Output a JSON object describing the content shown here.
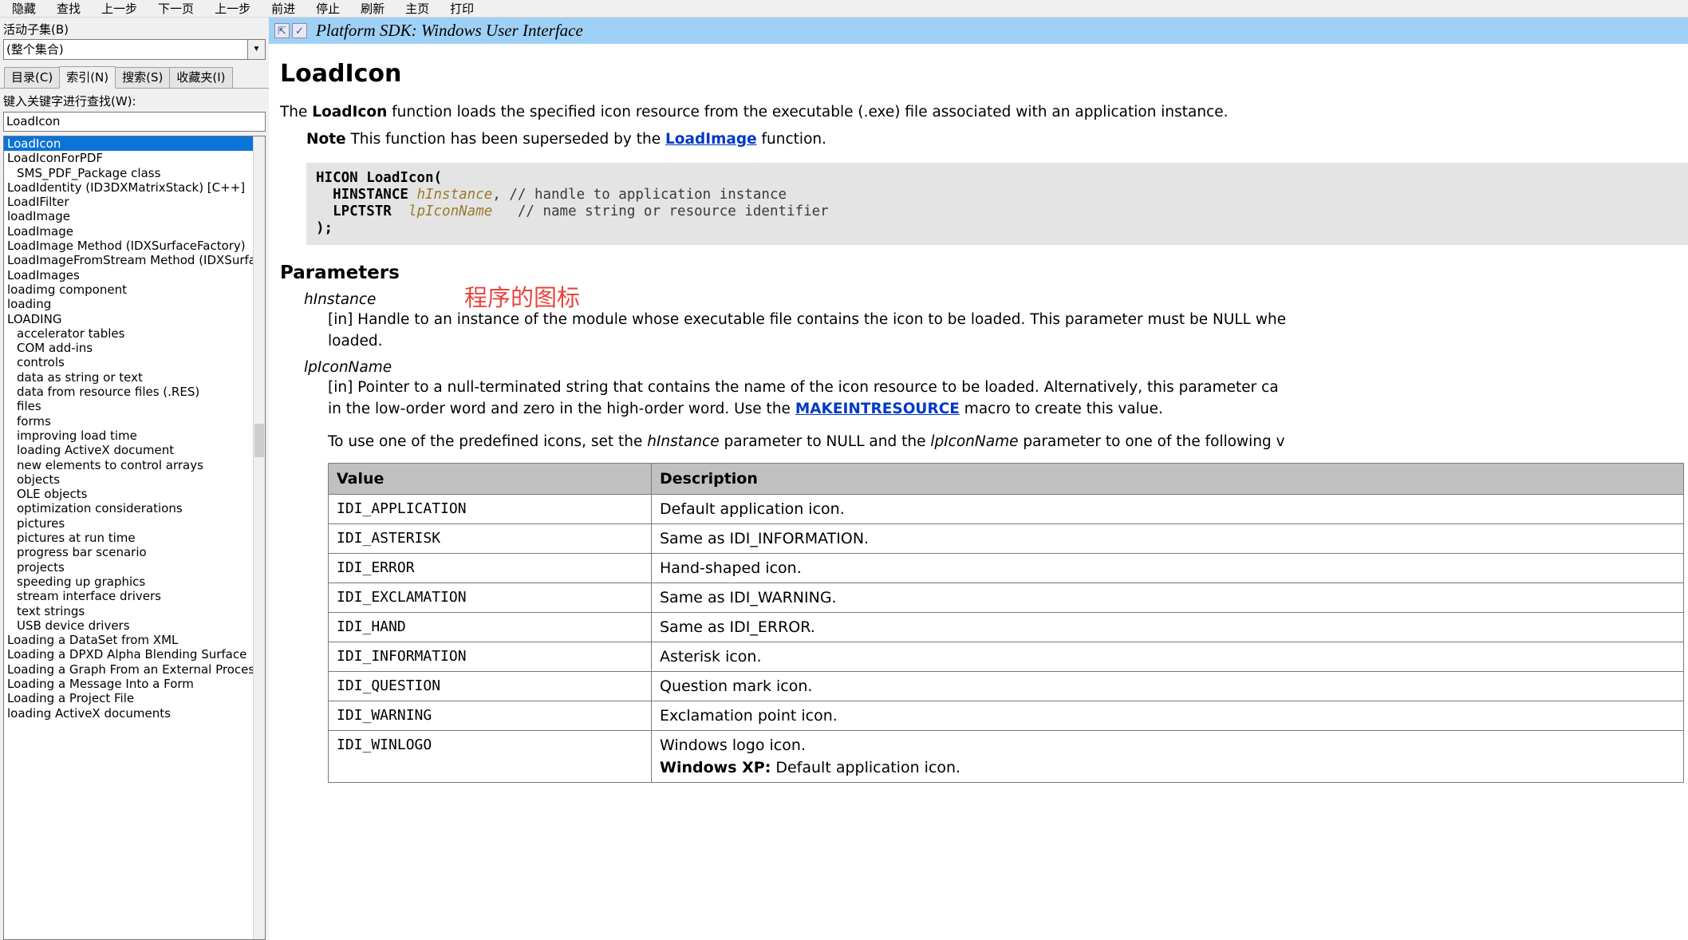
{
  "toolbar": {
    "buttons": [
      {
        "name": "hide",
        "label": "隐藏"
      },
      {
        "name": "locate",
        "label": "查找"
      },
      {
        "name": "back",
        "label": "上一步"
      },
      {
        "name": "next-page",
        "label": "下一页"
      },
      {
        "name": "prev-step",
        "label": "上一步"
      },
      {
        "name": "forward",
        "label": "前进"
      },
      {
        "name": "stop",
        "label": "停止"
      },
      {
        "name": "refresh",
        "label": "刷新"
      },
      {
        "name": "home",
        "label": "主页"
      },
      {
        "name": "print",
        "label": "打印"
      }
    ]
  },
  "sidebar": {
    "subset_label": "活动子集(B)",
    "subset_value": "(整个集合)",
    "subset_arrow_glyph": "▼",
    "tabs": [
      {
        "name": "contents",
        "label": "目录(C)",
        "active": false
      },
      {
        "name": "index",
        "label": "索引(N)",
        "active": true
      },
      {
        "name": "search",
        "label": "搜索(S)",
        "active": false
      },
      {
        "name": "favorites",
        "label": "收藏夹(I)",
        "active": false
      }
    ],
    "keyword_label": "键入关键字进行查找(W):",
    "keyword_value": "LoadIcon",
    "keyword_placeholder": "",
    "index_items": [
      {
        "text": "LoadIcon",
        "sub": false,
        "selected": true
      },
      {
        "text": "LoadIconForPDF",
        "sub": false,
        "selected": false
      },
      {
        "text": "SMS_PDF_Package class",
        "sub": true,
        "selected": false
      },
      {
        "text": "LoadIdentity (ID3DXMatrixStack) [C++]",
        "sub": false,
        "selected": false
      },
      {
        "text": "LoadIFilter",
        "sub": false,
        "selected": false
      },
      {
        "text": "loadImage",
        "sub": false,
        "selected": false
      },
      {
        "text": "LoadImage",
        "sub": false,
        "selected": false
      },
      {
        "text": "LoadImage Method (IDXSurfaceFactory)",
        "sub": false,
        "selected": false
      },
      {
        "text": "LoadImageFromStream Method (IDXSurfaceFa",
        "sub": false,
        "selected": false
      },
      {
        "text": "LoadImages",
        "sub": false,
        "selected": false
      },
      {
        "text": "loadimg component",
        "sub": false,
        "selected": false
      },
      {
        "text": "loading",
        "sub": false,
        "selected": false
      },
      {
        "text": "LOADING",
        "sub": false,
        "selected": false
      },
      {
        "text": "accelerator tables",
        "sub": true,
        "selected": false
      },
      {
        "text": "COM add-ins",
        "sub": true,
        "selected": false
      },
      {
        "text": "controls",
        "sub": true,
        "selected": false
      },
      {
        "text": "data as string or text",
        "sub": true,
        "selected": false
      },
      {
        "text": "data from resource files (.RES)",
        "sub": true,
        "selected": false
      },
      {
        "text": "files",
        "sub": true,
        "selected": false
      },
      {
        "text": "forms",
        "sub": true,
        "selected": false
      },
      {
        "text": "improving load time",
        "sub": true,
        "selected": false
      },
      {
        "text": "loading ActiveX document",
        "sub": true,
        "selected": false
      },
      {
        "text": "new elements to control arrays",
        "sub": true,
        "selected": false
      },
      {
        "text": "objects",
        "sub": true,
        "selected": false
      },
      {
        "text": "OLE objects",
        "sub": true,
        "selected": false
      },
      {
        "text": "optimization considerations",
        "sub": true,
        "selected": false
      },
      {
        "text": "pictures",
        "sub": true,
        "selected": false
      },
      {
        "text": "pictures at run time",
        "sub": true,
        "selected": false
      },
      {
        "text": "progress bar scenario",
        "sub": true,
        "selected": false
      },
      {
        "text": "projects",
        "sub": true,
        "selected": false
      },
      {
        "text": "speeding up graphics",
        "sub": true,
        "selected": false
      },
      {
        "text": "stream interface drivers",
        "sub": true,
        "selected": false
      },
      {
        "text": "text strings",
        "sub": true,
        "selected": false
      },
      {
        "text": "USB device drivers",
        "sub": true,
        "selected": false
      },
      {
        "text": "Loading a DataSet from XML",
        "sub": false,
        "selected": false
      },
      {
        "text": "Loading a DPXD Alpha Blending Surface",
        "sub": false,
        "selected": false
      },
      {
        "text": "Loading a Graph From an External Process",
        "sub": false,
        "selected": false
      },
      {
        "text": "Loading a Message Into a Form",
        "sub": false,
        "selected": false
      },
      {
        "text": "Loading a Project File",
        "sub": false,
        "selected": false
      },
      {
        "text": "loading ActiveX documents",
        "sub": false,
        "selected": false
      }
    ]
  },
  "document": {
    "titlebar": {
      "title": "Platform SDK: Windows User Interface",
      "icon_expand": "⇱",
      "icon_check": "✓"
    },
    "page_title": "LoadIcon",
    "intro_pre": "The ",
    "intro_fn": "LoadIcon",
    "intro_post": " function loads the specified icon resource from the executable (.exe) file associated with an application instance.",
    "note_label": "Note",
    "note_pre": "  This function has been superseded by the ",
    "note_link": "LoadImage",
    "note_post": " function.",
    "code": {
      "line1_kw": "HICON LoadIcon(",
      "line2_kw": "  HINSTANCE ",
      "line2_var": "hInstance",
      "line2_cmt": ", // handle to application instance",
      "line3_kw": "  LPCTSTR  ",
      "line3_var": "lpIconName",
      "line3_cmt": "   // name string or resource identifier",
      "line4": ");"
    },
    "parameters_heading": "Parameters",
    "annotation": "程序的图标",
    "params": [
      {
        "name": "hInstance",
        "desc_line1": "[in] Handle to an instance of the module whose executable file contains the icon to be loaded. This parameter must be NULL whe",
        "desc_line2": "loaded."
      },
      {
        "name": "lpIconName",
        "desc_line1": "[in] Pointer to a null-terminated string that contains the name of the icon resource to be loaded. Alternatively, this parameter ca",
        "desc_line2_pre": "in the low-order word and zero in the high-order word. Use the ",
        "desc_link": "MAKEINTRESOURCE",
        "desc_line2_post": " macro to create this value."
      }
    ],
    "predef_pre": "To use one of the predefined icons, set the ",
    "predef_i1": "hInstance",
    "predef_mid": " parameter to NULL and the ",
    "predef_i2": "lpIconName",
    "predef_post": " parameter to one of the following v",
    "table": {
      "headers": [
        "Value",
        "Description"
      ],
      "rows": [
        {
          "value": "IDI_APPLICATION",
          "description": "Default application icon.",
          "extra_bold": "",
          "extra_text": ""
        },
        {
          "value": "IDI_ASTERISK",
          "description": "Same as IDI_INFORMATION.",
          "extra_bold": "",
          "extra_text": ""
        },
        {
          "value": "IDI_ERROR",
          "description": "Hand-shaped icon.",
          "extra_bold": "",
          "extra_text": ""
        },
        {
          "value": "IDI_EXCLAMATION",
          "description": "Same as IDI_WARNING.",
          "extra_bold": "",
          "extra_text": ""
        },
        {
          "value": "IDI_HAND",
          "description": "Same as IDI_ERROR.",
          "extra_bold": "",
          "extra_text": ""
        },
        {
          "value": "IDI_INFORMATION",
          "description": "Asterisk icon.",
          "extra_bold": "",
          "extra_text": ""
        },
        {
          "value": "IDI_QUESTION",
          "description": "Question mark icon.",
          "extra_bold": "",
          "extra_text": ""
        },
        {
          "value": "IDI_WARNING",
          "description": "Exclamation point icon.",
          "extra_bold": "",
          "extra_text": ""
        },
        {
          "value": "IDI_WINLOGO",
          "description": "Windows logo icon.",
          "extra_bold": "Windows XP:",
          "extra_text": " Default application icon."
        }
      ]
    }
  },
  "colors": {
    "titlebar_bg": "#9fd0f5",
    "selection_blue": "#0a74d8",
    "annotation_red": "#e8453c",
    "link_blue": "#0039c8",
    "code_bg": "#e4e4e4",
    "table_header_bg": "#c0c0c0"
  }
}
